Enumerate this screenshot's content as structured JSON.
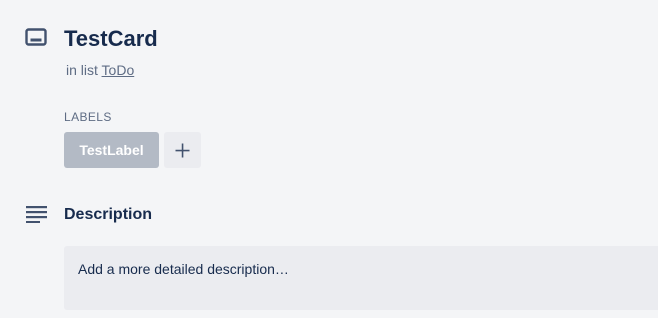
{
  "card": {
    "icon": "card-icon",
    "title": "TestCard",
    "in_list_prefix": "in list",
    "list_name": "ToDo"
  },
  "labels": {
    "heading": "LABELS",
    "items": [
      {
        "name": "TestLabel",
        "color": "#b3bac5"
      }
    ],
    "add_icon": "plus-icon"
  },
  "description": {
    "icon": "description-lines-icon",
    "title": "Description",
    "placeholder": "Add a more detailed description…"
  },
  "colors": {
    "background": "#f4f5f7",
    "text_primary": "#172b4d",
    "text_secondary": "#5e6c84",
    "field_background": "#ebecf0"
  }
}
